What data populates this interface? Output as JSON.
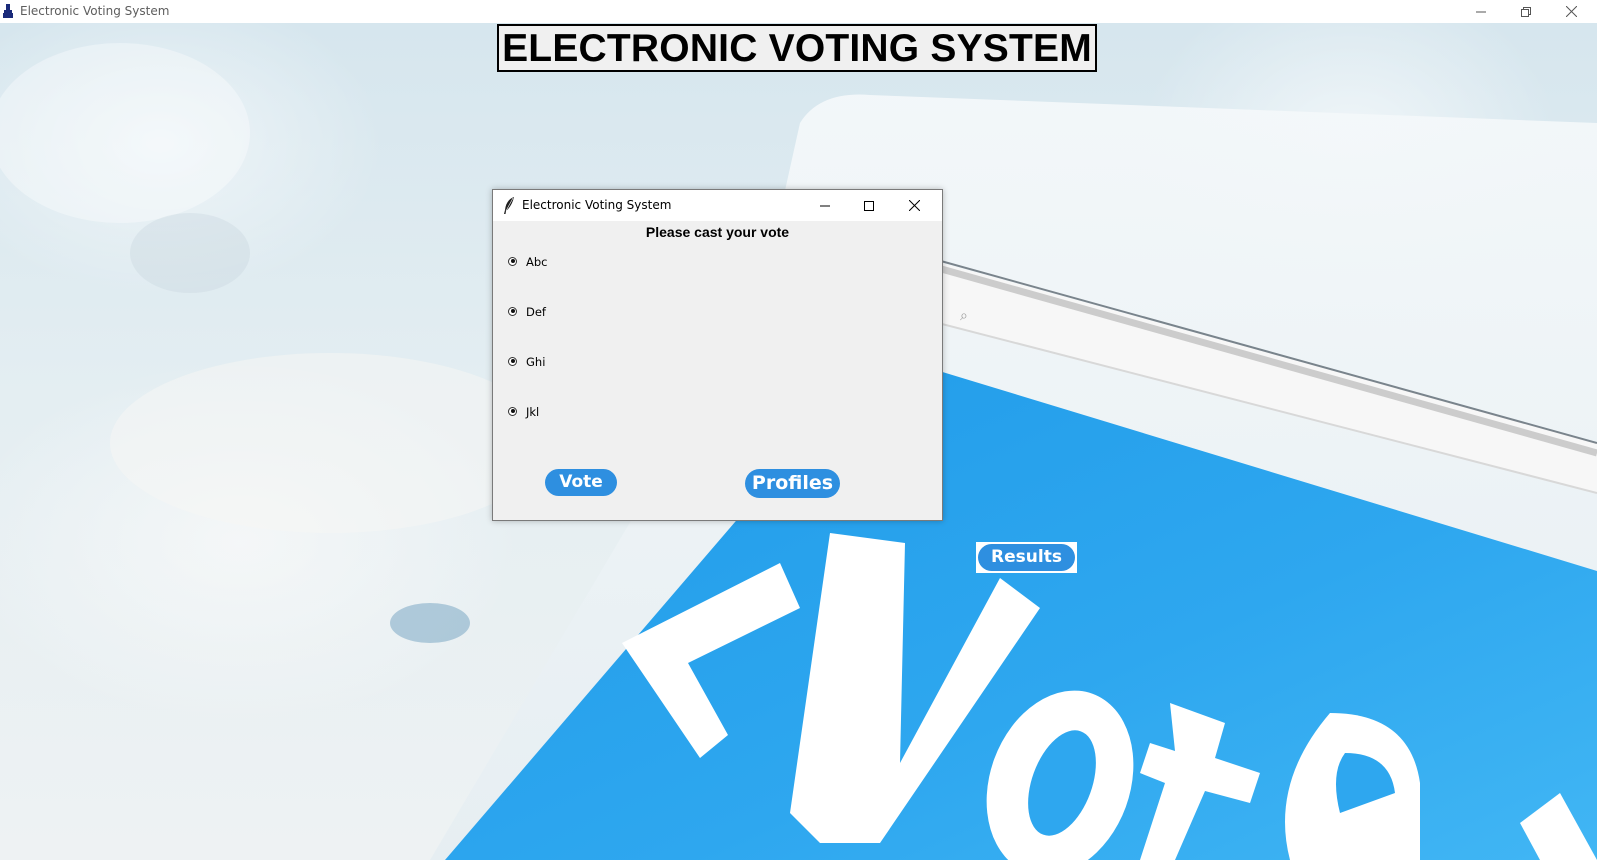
{
  "main_window": {
    "title": "Electronic Voting System",
    "controls": [
      "minimize-icon",
      "restore-icon",
      "close-icon"
    ]
  },
  "heading": "ELECTRONIC VOTING SYSTEM",
  "results_button": "Results",
  "background": {
    "poster_text": "<Vote",
    "accent_color": "#2ea7ef"
  },
  "dialog": {
    "title": "Electronic Voting System",
    "prompt": "Please cast your vote",
    "options": [
      "Abc",
      "Def",
      "Ghi",
      "Jkl"
    ],
    "vote_button": "Vote",
    "profiles_button": "Profiles"
  },
  "colors": {
    "button_blue": "#2e8fe0",
    "dialog_bg": "#f0f0f0"
  }
}
